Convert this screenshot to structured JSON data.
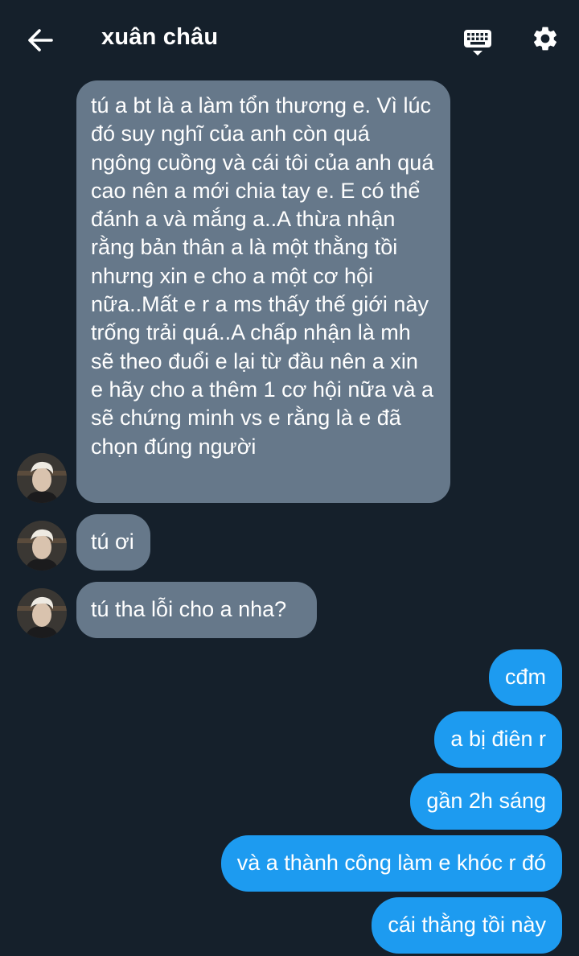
{
  "header": {
    "title": "xuân châu",
    "back_icon": "arrow-left-icon",
    "keyboard_icon": "keyboard-icon",
    "settings_icon": "gear-icon"
  },
  "messages": {
    "incoming": [
      {
        "text": "tú a bt là a làm tổn thương e. Vì lúc đó suy nghĩ của anh còn quá ngông cuồng và cái tôi của anh quá cao nên a mới chia tay e. E có thể đánh a và mắng a..A thừa nhận rằng bản thân a là một thằng tồi nhưng xin e cho a một cơ hội nữa..Mất e r a ms thấy thế giới này trống trải quá..A chấp nhận là mh sẽ theo đuổi e lại từ đầu nên a xin e hãy cho a thêm 1 cơ hội nữa và a sẽ chứng minh vs e rằng là e đã chọn đúng người"
      },
      {
        "text": "tú ơi"
      },
      {
        "text": "tú tha lỗi cho a nha?"
      }
    ],
    "outgoing": [
      {
        "text": "cđm"
      },
      {
        "text": "a bị điên r"
      },
      {
        "text": "gần 2h sáng"
      },
      {
        "text": "và a thành công làm e khóc r đó"
      },
      {
        "text": "cái thằng tồi này"
      }
    ]
  },
  "colors": {
    "background": "#15202b",
    "incoming_bubble": "#66788a",
    "outgoing_bubble": "#1d9bf0"
  }
}
